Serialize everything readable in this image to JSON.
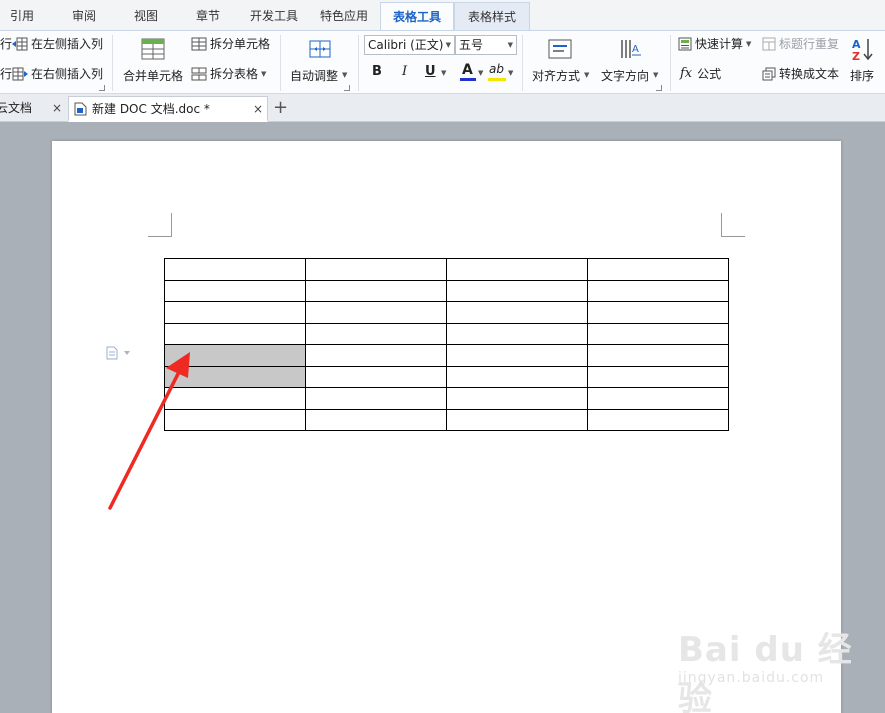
{
  "menu": {
    "tabs": [
      {
        "label": "引用"
      },
      {
        "label": "审阅"
      },
      {
        "label": "视图"
      },
      {
        "label": "章节"
      },
      {
        "label": "开发工具"
      },
      {
        "label": "特色应用"
      },
      {
        "label": "表格工具"
      },
      {
        "label": "表格样式"
      }
    ],
    "active": "表格工具"
  },
  "ribbon": {
    "insert_left_col": "在左侧插入列",
    "insert_right_col": "在右侧插入列",
    "insert_above_clip": "行",
    "insert_below_clip": "行",
    "merge_cells": "合并单元格",
    "split_cells": "拆分单元格",
    "split_table": "拆分表格",
    "auto_fit": "自动调整",
    "font_name": "Calibri (正文)",
    "font_size": "五号",
    "bold": "B",
    "italic": "I",
    "underline": "U",
    "font_color_label": "A",
    "highlight_label": "ab",
    "align": "对齐方式",
    "text_direction": "文字方向",
    "quick_calc": "快速计算",
    "repeat_header": "标题行重复",
    "formula_fx": "fx",
    "formula": "公式",
    "to_text": "转换成文本",
    "sort": "排序"
  },
  "colors": {
    "accent": "#1d63c7",
    "font_color_bar": "#2233cc",
    "highlight_bar": "#f5e600",
    "selected_cell": "#c8c8c8",
    "arrow": "#ee2a22"
  },
  "doc_tabs": [
    {
      "label": "云文档",
      "active": false
    },
    {
      "label": "新建 DOC 文档.doc *",
      "active": true
    }
  ],
  "doc_tab_close": "×",
  "doc_tab_add": "+",
  "table": {
    "rows": 8,
    "cols": 4,
    "selected": [
      [
        4,
        0
      ],
      [
        5,
        0
      ]
    ]
  },
  "watermark": {
    "main": "Bai du 经验",
    "sub": "jingyan.baidu.com"
  }
}
